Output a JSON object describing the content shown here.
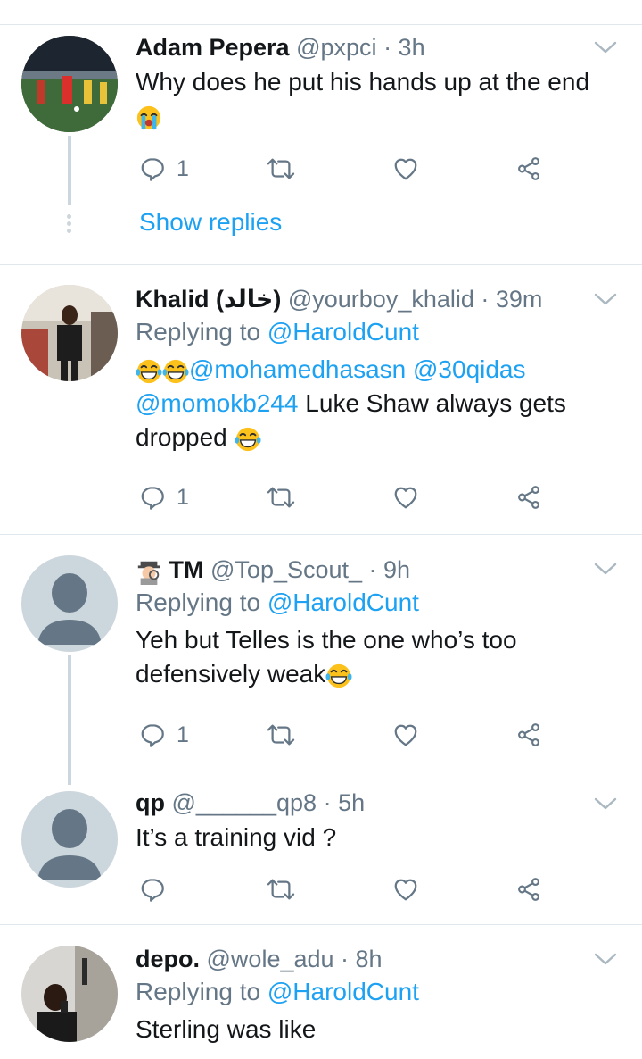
{
  "tweets": [
    {
      "name": "Adam Pepera",
      "handle": "@pxpci",
      "time": "· 3h",
      "text": [
        "Why does he put his hands up at the end"
      ],
      "emoji_line": "crying-face",
      "reply_count": "1",
      "show_replies": "Show replies"
    },
    {
      "name": "Khalid (خالد)",
      "handle": "@yourboy_khalid",
      "time": "· 39m",
      "replying_prefix": "Replying to",
      "replying_to": "@HaroldCunt",
      "mentions_line1": "@mohamedhasasn @30qidas",
      "mention_line2": "@momokb244",
      "text_line2": " Luke Shaw always gets",
      "text_line3": "dropped",
      "reply_count": "1"
    },
    {
      "name": "TM",
      "handle": "@Top_Scout_",
      "time": "· 9h",
      "replying_prefix": "Replying to",
      "replying_to": "@HaroldCunt",
      "text_line1": "Yeh but Telles is the one who’s too",
      "text_line2": "defensively weak",
      "reply_count": "1"
    },
    {
      "name": "qp",
      "handle": "@______qp8",
      "time": "· 5h",
      "text_line1": "It’s a training vid ?",
      "reply_count": ""
    },
    {
      "name": "depo.",
      "handle": "@wole_adu",
      "time": "· 8h",
      "replying_prefix": "Replying to",
      "replying_to": "@HaroldCunt",
      "text_line1": "Sterling was like"
    }
  ],
  "colors": {
    "link": "#1da1f2",
    "muted": "#657786",
    "text": "#14171a",
    "divider": "#e1e8ed"
  },
  "icons": [
    "reply-icon",
    "retweet-icon",
    "like-icon",
    "share-icon",
    "chevron-down-icon",
    "laughing-emoji",
    "crying-emoji",
    "detective-emoji"
  ]
}
